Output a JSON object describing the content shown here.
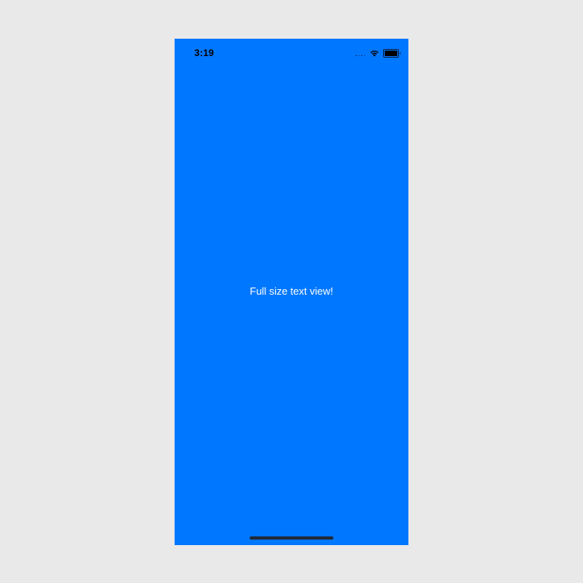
{
  "status_bar": {
    "time": "3:19",
    "icons": [
      "cellular-signal-icon",
      "wifi-icon",
      "battery-icon"
    ]
  },
  "main": {
    "text": "Full size text view!",
    "background_color": "#0077ff",
    "text_color": "#ffffff"
  },
  "page": {
    "background_color": "#e9e9e9"
  }
}
